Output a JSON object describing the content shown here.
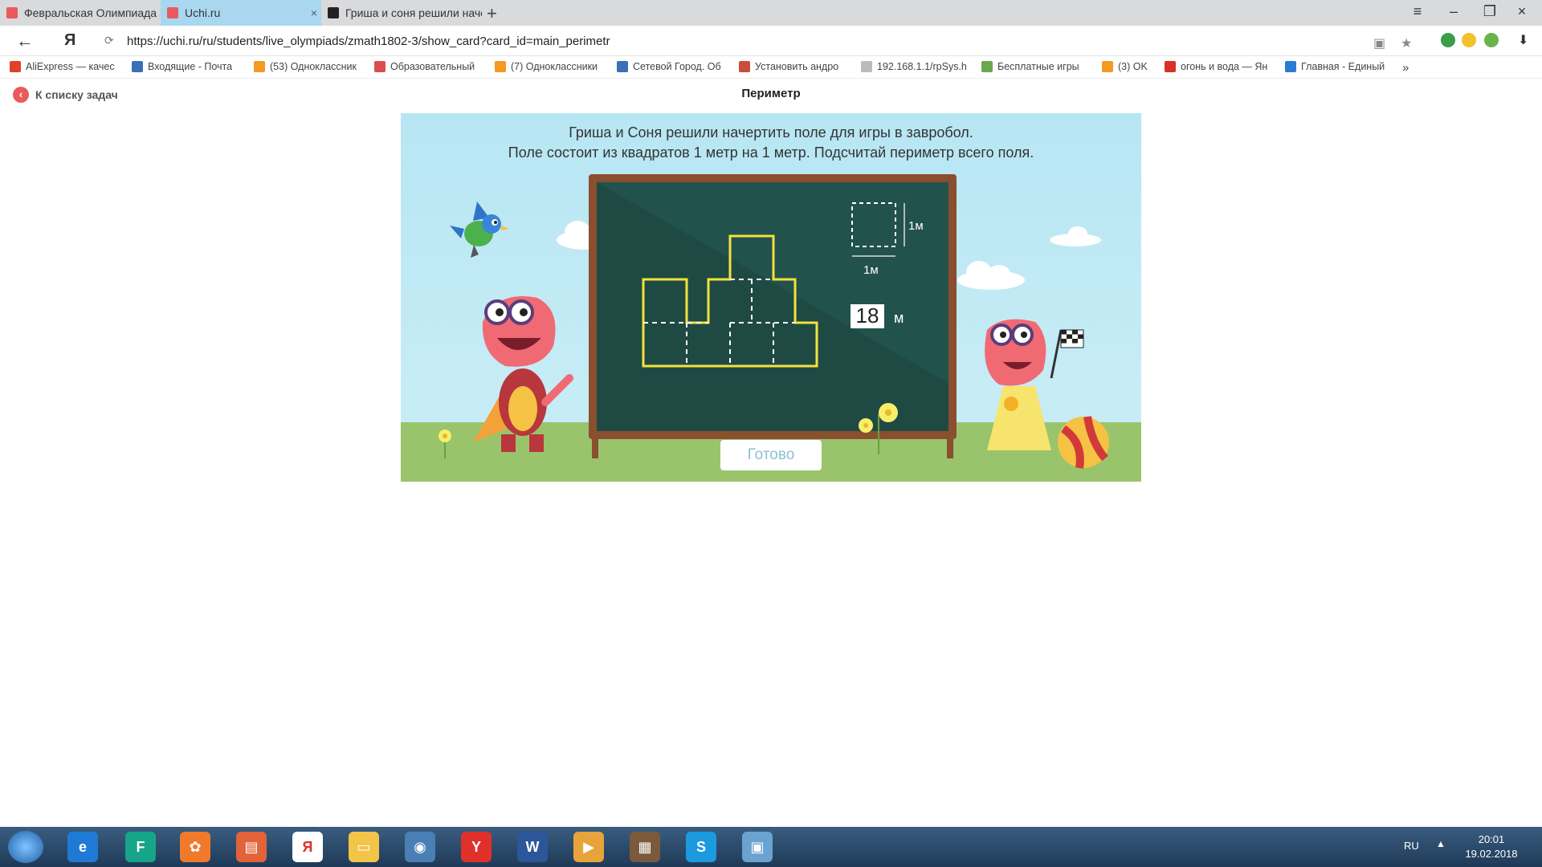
{
  "browser": {
    "tabs": [
      {
        "title": "Февральская Олимпиада З",
        "favicon_color": "#e85a5a",
        "active": false
      },
      {
        "title": "Uchi.ru",
        "favicon_color": "#e85a5a",
        "active": true
      },
      {
        "title": "Гриша и соня решили наче",
        "favicon_color": "#222222",
        "active": false
      }
    ],
    "new_tab": "+",
    "url": "https://uchi.ru/ru/students/live_olympiads/zmath1802-3/show_card?card_id=main_perimetr",
    "back": "←",
    "ya": "Я",
    "bookmarks": [
      {
        "label": "AliExpress — качес",
        "color": "#e0412a"
      },
      {
        "label": "Входящие - Почта",
        "color": "#3b6fb6"
      },
      {
        "label": "(53) Одноклассник",
        "color": "#f39a23"
      },
      {
        "label": "Образовательный",
        "color": "#d94f4f"
      },
      {
        "label": "(7) Одноклассники",
        "color": "#f39a23"
      },
      {
        "label": "Сетевой Город. Об",
        "color": "#3b6fb6"
      },
      {
        "label": "Установить андро",
        "color": "#c94e3c"
      },
      {
        "label": "192.168.1.1/rpSys.h",
        "color": "#bbbbbb"
      },
      {
        "label": "Бесплатные игры",
        "color": "#6aa84f"
      },
      {
        "label": "(3) OK",
        "color": "#f39a23"
      },
      {
        "label": "огонь и вода — Ян",
        "color": "#d93025"
      },
      {
        "label": "Главная - Единый",
        "color": "#2a7bd4"
      }
    ],
    "more": "»"
  },
  "page": {
    "back_link": "К списку задач",
    "title": "Периметр"
  },
  "task": {
    "question_line1": "Гриша и Соня решили начертить поле для игры в завробол.",
    "question_line2": "Поле состоит из квадратов 1 метр на 1 метр. Подсчитай периметр всего поля.",
    "unit_side": "1м",
    "unit_bottom": "1м",
    "answer_value": "18",
    "answer_unit": "м",
    "done_button": "Готово"
  },
  "taskbar": {
    "lang": "RU",
    "time": "20:01",
    "date": "19.02.2018"
  }
}
